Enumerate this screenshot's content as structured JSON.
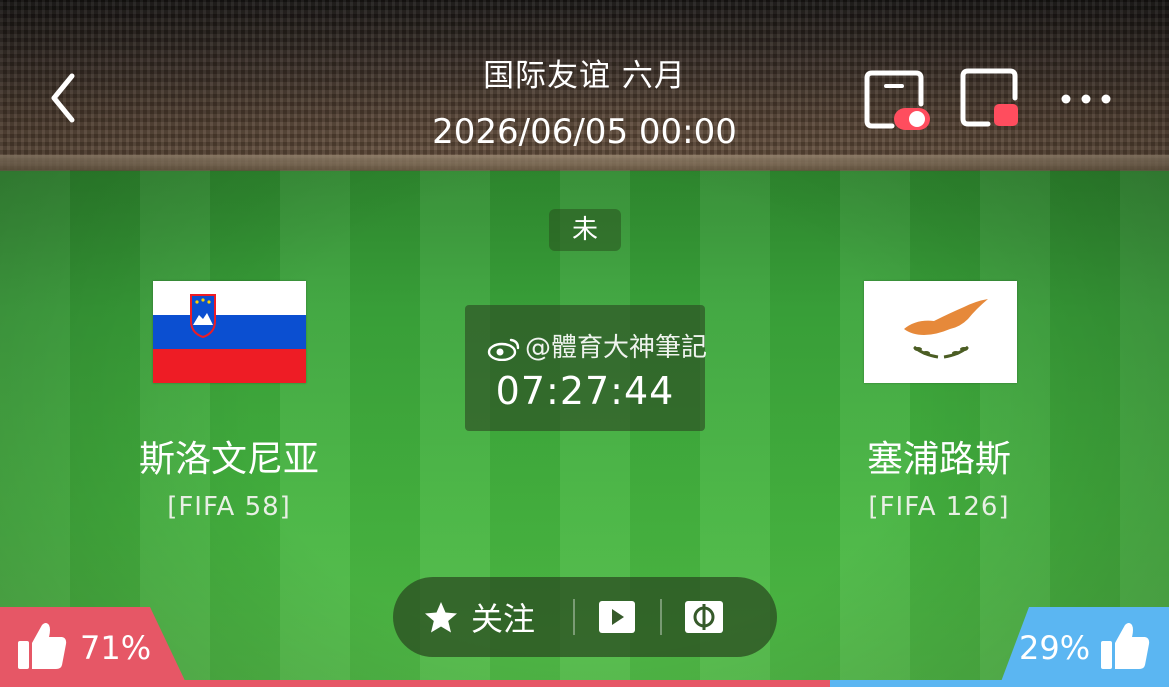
{
  "header": {
    "competition": "国际友谊 六月",
    "datetime": "2026/06/05 00:00",
    "icons": [
      "back-icon",
      "pip-toggle-icon",
      "float-window-icon",
      "more-icon"
    ]
  },
  "match": {
    "status": "未",
    "home": {
      "name": "斯洛文尼亚",
      "rank": "[FIFA 58]"
    },
    "away": {
      "name": "塞浦路斯",
      "rank": "[FIFA 126]"
    },
    "countdown": "07:27:44",
    "watermark": "@體育大神筆記"
  },
  "actions": {
    "follow_label": "关注"
  },
  "votes": {
    "home_pct": "71%",
    "away_pct": "29%",
    "home_fraction": 0.71
  },
  "colors": {
    "home_vote": "#e65766",
    "away_vote": "#5bb6f2",
    "toggle_red": "#ff4d5e"
  }
}
